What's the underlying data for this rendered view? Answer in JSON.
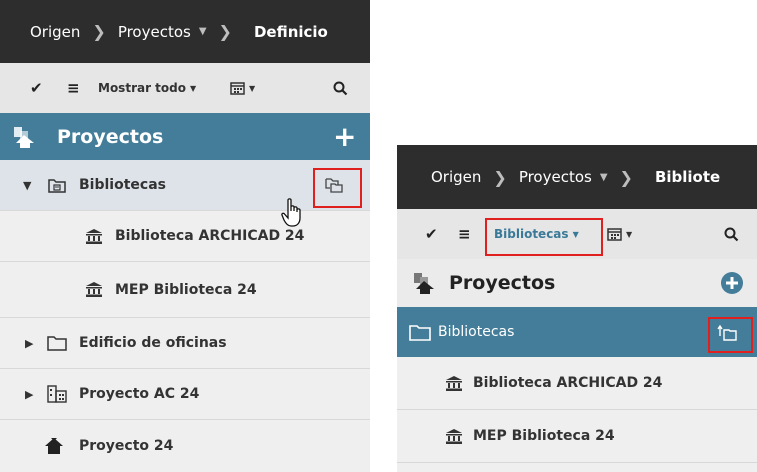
{
  "left": {
    "breadcrumb": {
      "origin": "Origen",
      "projects": "Proyectos",
      "current": "Definicio"
    },
    "toolbar": {
      "filter_label": "Mostrar todo"
    },
    "header": {
      "title": "Proyectos",
      "add_glyph": "+"
    },
    "rows": [
      {
        "label": "Bibliotecas",
        "icon": "library-folder-icon"
      },
      {
        "label": "Biblioteca ARCHICAD 24",
        "icon": "library-building-icon"
      },
      {
        "label": "MEP Biblioteca 24",
        "icon": "library-building-icon"
      },
      {
        "label": "Edificio de oficinas",
        "icon": "folder-icon"
      },
      {
        "label": "Proyecto AC 24",
        "icon": "building-project-icon"
      },
      {
        "label": "Proyecto 24",
        "icon": "house-project-icon"
      }
    ]
  },
  "right": {
    "breadcrumb": {
      "origin": "Origen",
      "projects": "Proyectos",
      "current": "Bibliote"
    },
    "toolbar": {
      "filter_label": "Bibliotecas"
    },
    "header": {
      "title": "Proyectos"
    },
    "rows": [
      {
        "label": "Bibliotecas",
        "icon": "folder-icon"
      },
      {
        "label": "Biblioteca ARCHICAD 24",
        "icon": "library-building-icon"
      },
      {
        "label": "MEP Biblioteca 24",
        "icon": "library-building-icon"
      }
    ]
  },
  "colors": {
    "accent": "#437d99",
    "highlight": "#e0201f",
    "breadcrumb_bg": "#2d2d2d",
    "toolbar_bg": "#e6e6e6",
    "row_bg": "#efefef",
    "selected_row_bg": "#dde3e8"
  }
}
